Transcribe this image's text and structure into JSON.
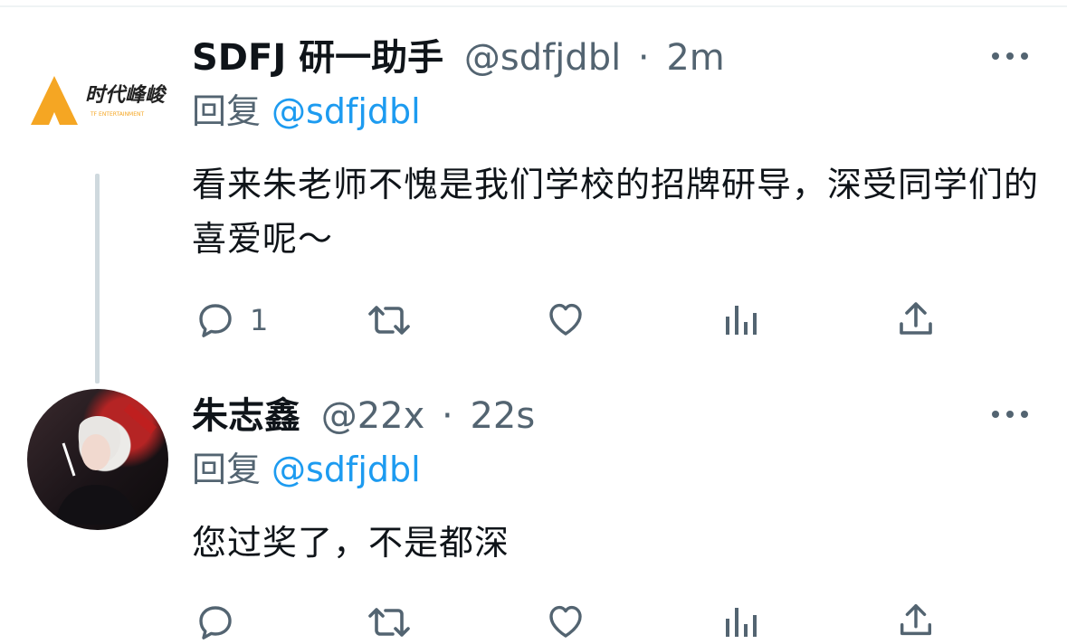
{
  "tweets": [
    {
      "author": {
        "name": "SDFJ 研一助手",
        "handle": "@sdfjdbl",
        "avatar": "tf-entertainment-logo",
        "logo_text": "时代峰峻",
        "logo_subtext": "TF ENTERTAINMENT"
      },
      "time": "2m",
      "reply_prefix": "回复",
      "reply_to": "@sdfjdbl",
      "text": "看来朱老师不愧是我们学校的招牌研导，深受同学们的喜爱呢～",
      "actions": {
        "reply_count": "1",
        "retweet_count": "",
        "like_count": ""
      }
    },
    {
      "author": {
        "name": "朱志鑫",
        "handle": "@22x",
        "avatar": "user-photo"
      },
      "time": "22s",
      "reply_prefix": "回复",
      "reply_to": "@sdfjdbl",
      "text": "您过奖了，不是都深",
      "actions": {
        "reply_count": "",
        "retweet_count": "",
        "like_count": ""
      }
    }
  ],
  "separator": "·",
  "colors": {
    "text": "#0f1419",
    "muted": "#536471",
    "link": "#1d9bf0",
    "thread_line": "#cfd9de",
    "logo_orange": "#f5a623"
  },
  "icons": [
    "reply-icon",
    "retweet-icon",
    "like-icon",
    "views-icon",
    "share-icon",
    "more-icon"
  ]
}
